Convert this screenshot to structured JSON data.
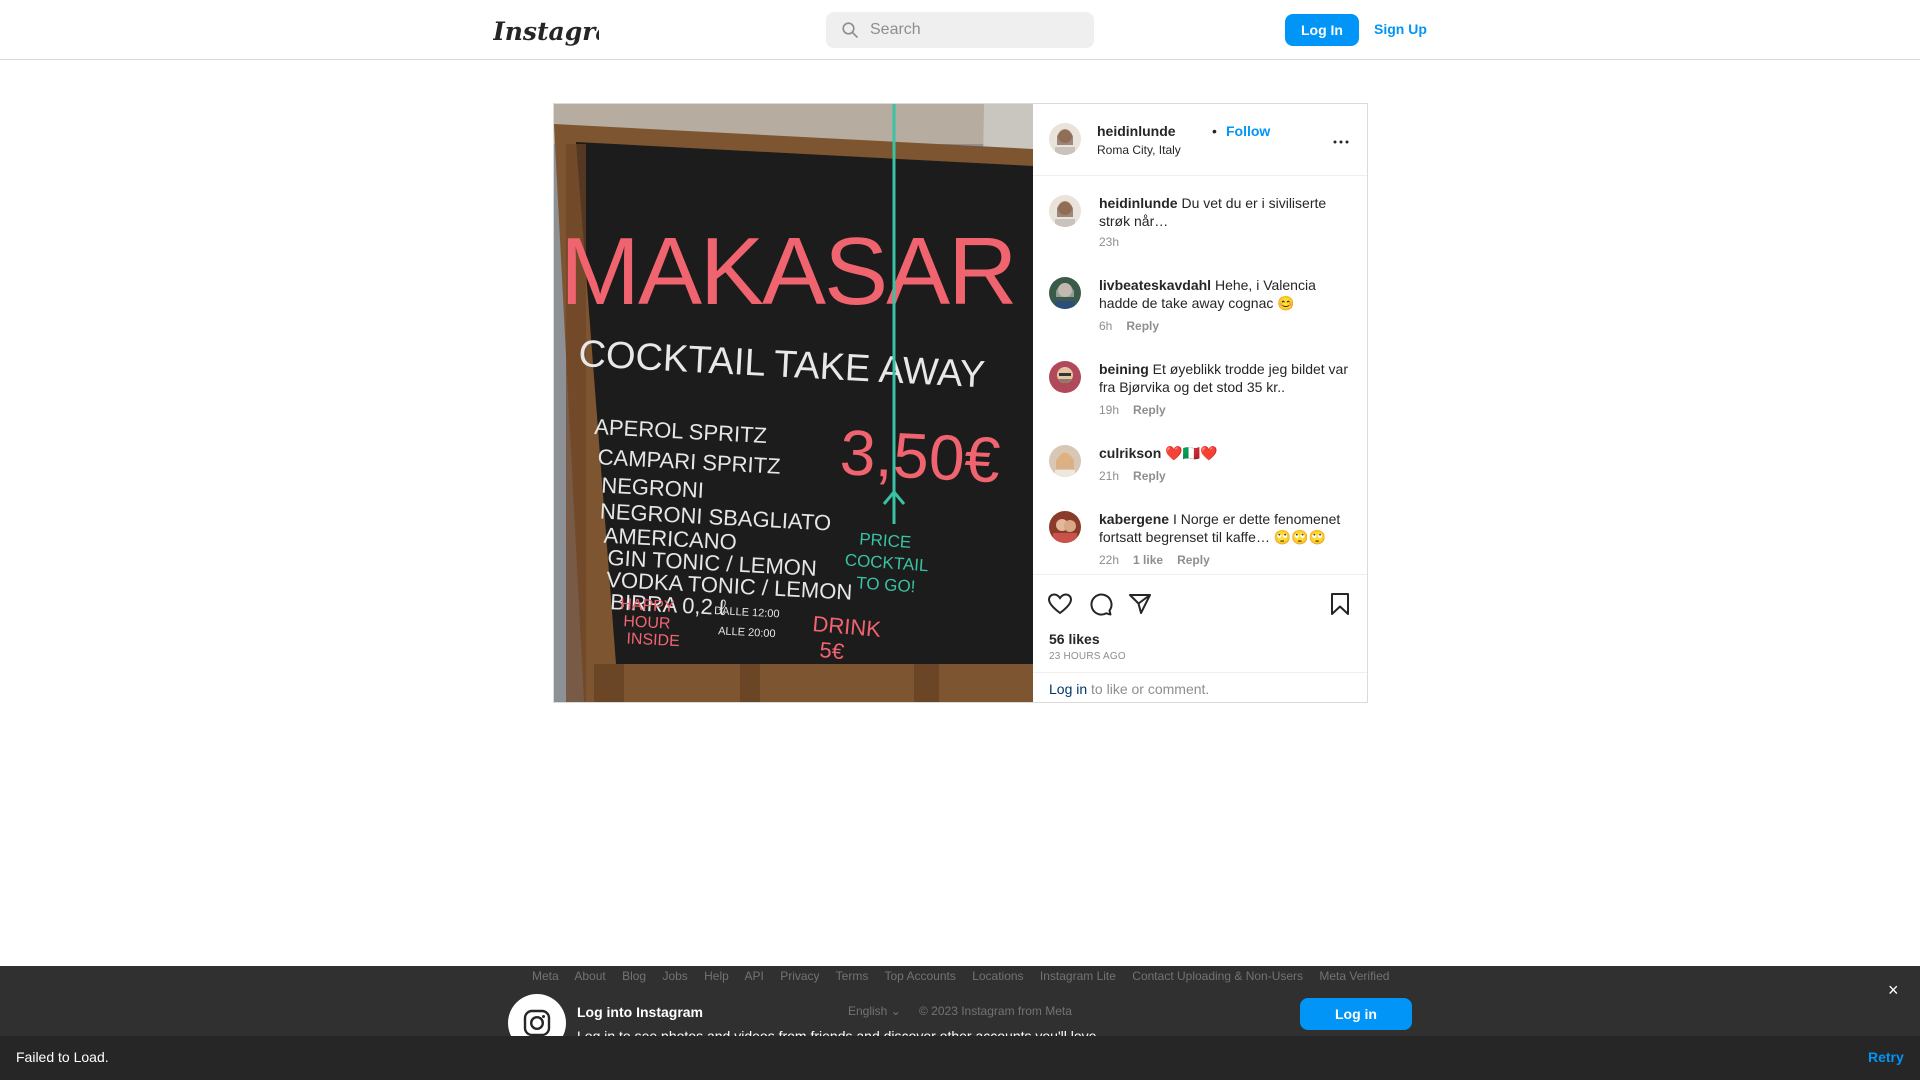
{
  "nav": {
    "logo_text": "Instagram",
    "search_placeholder": "Search",
    "login_label": "Log In",
    "signup_label": "Sign Up"
  },
  "post": {
    "photo_sign": {
      "name": "MAKASAR",
      "subtitle": "COCKTAIL TAKE AWAY",
      "menu": [
        "APEROL SPRITZ",
        "CAMPARI SPRITZ",
        "NEGRONI",
        "NEGRONI SBAGLIATO",
        "AMERICANO",
        "GIN TONIC / LEMON",
        "VODKA TONIC / LEMON",
        "BIRRA 0,2 ℓ"
      ],
      "price": "3,50€",
      "price_note": [
        "PRICE",
        "COCKTAIL",
        "TO GO!"
      ],
      "happy_hour": [
        "HAPPY",
        "HOUR",
        "INSIDE"
      ],
      "hours": [
        "DALLE 12:00",
        "ALLE 20:00"
      ],
      "drink": "DRINK",
      "drink_price": "5€"
    },
    "author": "heidinlunde",
    "follow_label": "Follow",
    "location": "Roma City, Italy",
    "comments": [
      {
        "user": "heidinlunde",
        "text": "Du vet du er i siviliserte strøk når…",
        "time": "23h",
        "likes": "",
        "reply": ""
      },
      {
        "user": "livbeateskavdahl",
        "text": "Hehe, i Valencia hadde de take away cognac 😊",
        "time": "6h",
        "likes": "",
        "reply": "Reply"
      },
      {
        "user": "beining",
        "text": "Et øyeblikk trodde jeg bildet var fra Bjørvika og det stod 35 kr..",
        "time": "19h",
        "likes": "",
        "reply": "Reply"
      },
      {
        "user": "culrikson",
        "text": "❤️🇮🇹❤️",
        "time": "21h",
        "likes": "",
        "reply": "Reply"
      },
      {
        "user": "kabergene",
        "text": "I Norge er dette fenomenet fortsatt begrenset til kaffe… 🙄🙄🙄",
        "time": "22h",
        "likes": "1 like",
        "reply": "Reply"
      }
    ],
    "likes": "56 likes",
    "time_ago": "23 HOURS AGO",
    "login_link": "Log in",
    "login_rest": " to like or comment."
  },
  "footer": {
    "links": [
      "Meta",
      "About",
      "Blog",
      "Jobs",
      "Help",
      "API",
      "Privacy",
      "Terms",
      "Top Accounts",
      "Locations",
      "Instagram Lite",
      "Contact Uploading & Non-Users",
      "Meta Verified"
    ],
    "banner_title": "Log into Instagram",
    "banner_sub": "Log in to see photos and videos from friends and discover other accounts you'll love.",
    "language": "English",
    "copyright": "© 2023 Instagram from Meta",
    "login_label": "Log in",
    "close_label": "×"
  },
  "toast": {
    "message": "Failed to Load.",
    "retry_label": "Retry"
  },
  "colors": {
    "accent": "#0095f6",
    "link_dark": "#00376b",
    "border": "#dbdbdb",
    "muted": "#8e8e8e",
    "chalk_pink": "#f06470",
    "chalk_teal": "#39c2a3"
  }
}
